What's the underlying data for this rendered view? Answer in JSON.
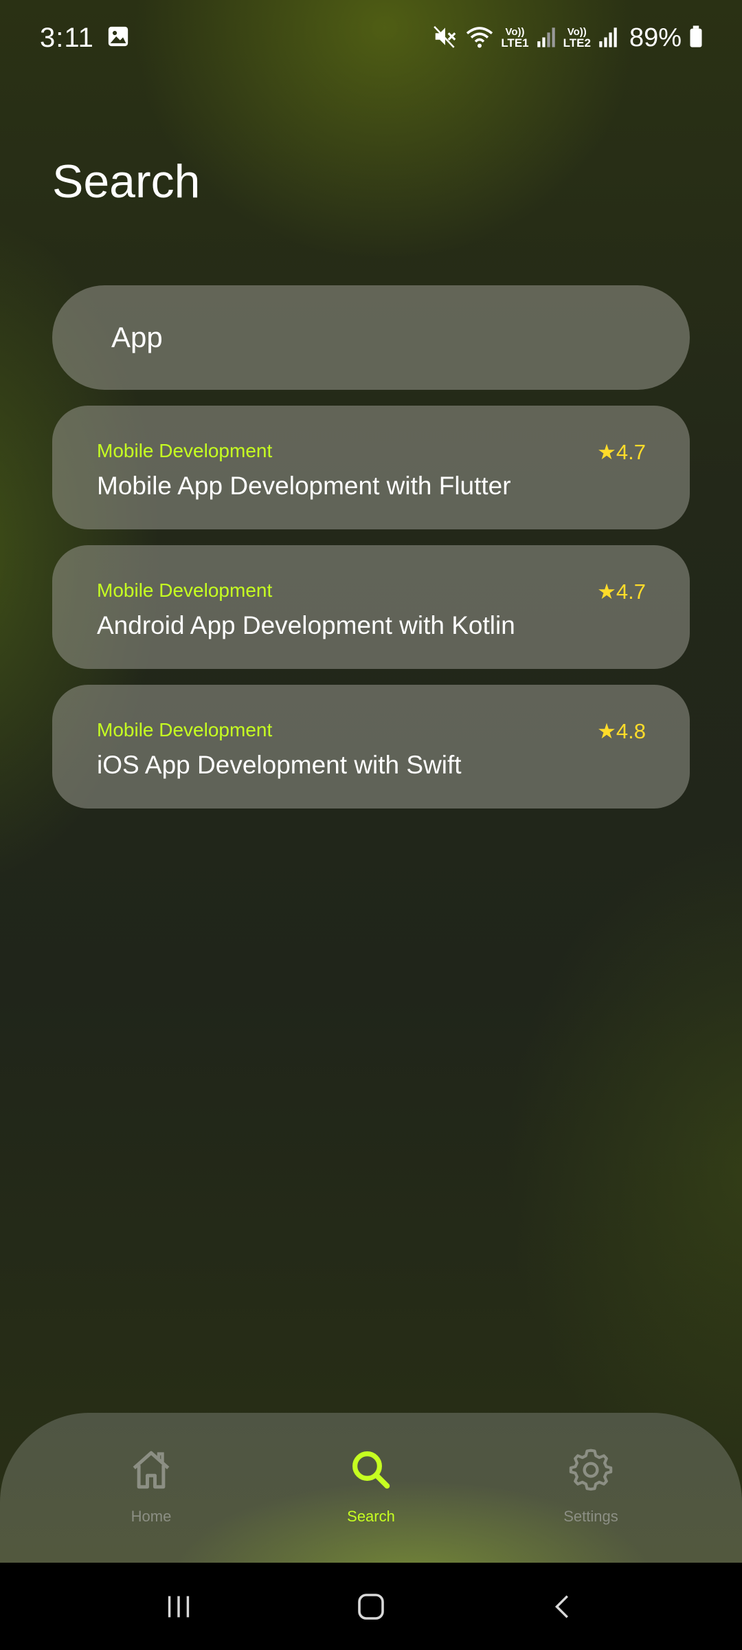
{
  "status_bar": {
    "time": "3:11",
    "battery": "89%",
    "sim1": {
      "vo": "Vo))",
      "lte": "LTE1"
    },
    "sim2": {
      "vo": "Vo))",
      "lte": "LTE2"
    },
    "icons": [
      "image-icon",
      "mute-icon",
      "wifi-icon",
      "signal-icon",
      "battery-icon"
    ]
  },
  "page": {
    "title": "Search"
  },
  "search": {
    "value": "App"
  },
  "results": [
    {
      "category": "Mobile Development",
      "title": "Mobile App Development with Flutter",
      "rating": "★4.7"
    },
    {
      "category": "Mobile Development",
      "title": "Android App Development with Kotlin",
      "rating": "★4.7"
    },
    {
      "category": "Mobile Development",
      "title": "iOS App Development with Swift",
      "rating": "★4.8"
    }
  ],
  "nav": {
    "items": [
      {
        "label": "Home",
        "icon": "home-icon",
        "active": false
      },
      {
        "label": "Search",
        "icon": "search-icon",
        "active": true
      },
      {
        "label": "Settings",
        "icon": "gear-icon",
        "active": false
      }
    ]
  },
  "colors": {
    "accent": "#c6ff21",
    "rating": "#ffdc2a",
    "card": "#96968c",
    "inactive_nav": "#8c8f84"
  }
}
